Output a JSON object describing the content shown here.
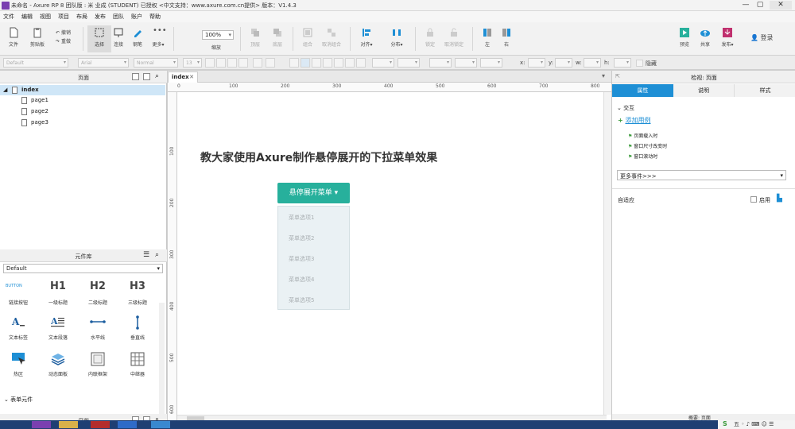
{
  "titlebar": {
    "title": "未命名 - Axure RP 8 团队版 : 米 业成 (STUDENT) 已授权 <中文支持：www.axure.com.cn提供> 版本：V1.4.3"
  },
  "menu": [
    "文件",
    "编辑",
    "视图",
    "项目",
    "布局",
    "发布",
    "团队",
    "账户",
    "帮助"
  ],
  "toolbar": {
    "tools": [
      "文件",
      "剪贴板",
      "撤销",
      "重做",
      "选择",
      "连接",
      "钢笔",
      "更多▾",
      "缩放",
      "顶层",
      "底层",
      "组合",
      "取消组合",
      "对齐▾",
      "分布▾",
      "锁定",
      "取消锁定",
      "左",
      "右",
      "预览",
      "共享",
      "发布▾"
    ],
    "zoom": "100%",
    "login": "登录"
  },
  "formatbar": {
    "style": "Default",
    "font": "Arial",
    "weight": "Normal",
    "size": "13",
    "x_label": "x:",
    "y_label": "y:",
    "w_label": "w:",
    "h_label": "h:",
    "hidden_label": "隐藏"
  },
  "pages_panel": {
    "title": "页面",
    "root": "index",
    "children": [
      "page1",
      "page2",
      "page3"
    ]
  },
  "library_panel": {
    "title": "元件库",
    "selected": "Default",
    "widgets": [
      "链接按钮",
      "一级标题",
      "二级标题",
      "三级标题",
      "文本标签",
      "文本段落",
      "水平线",
      "垂直线",
      "热区",
      "动态面板",
      "内联框架",
      "中继器"
    ],
    "h1": "H1",
    "h2": "H2",
    "h3": "H3",
    "button_caption": "BUTTON",
    "group": "表单元件"
  },
  "masters_panel": {
    "title": "母版"
  },
  "canvas": {
    "tab": "index",
    "ruler_h": [
      "0",
      "100",
      "200",
      "300",
      "400",
      "500",
      "600",
      "700",
      "800"
    ],
    "ruler_v": [
      "100",
      "200",
      "300",
      "400",
      "500",
      "600"
    ],
    "heading": "教大家使用Axure制作悬停展开的下拉菜单效果",
    "dropdown_button": "悬停展开菜单",
    "menu_items": [
      "菜单选项1",
      "菜单选项2",
      "菜单选项3",
      "菜单选项4",
      "菜单选项5"
    ]
  },
  "inspector": {
    "title": "检视: 页面",
    "tabs": [
      "属性",
      "说明",
      "样式"
    ],
    "section": "交互",
    "add_case": "添加用例",
    "events": [
      "页面载入时",
      "窗口尺寸改变时",
      "窗口滚动时"
    ],
    "more_events": "更多事件>>>",
    "adaptive": "自适应",
    "enable": "启用",
    "footer_label": "概要: 页面"
  },
  "colors": {
    "accent": "#27b09c",
    "tab_active": "#1e8fd5",
    "taskbar": "#1f3f73"
  }
}
